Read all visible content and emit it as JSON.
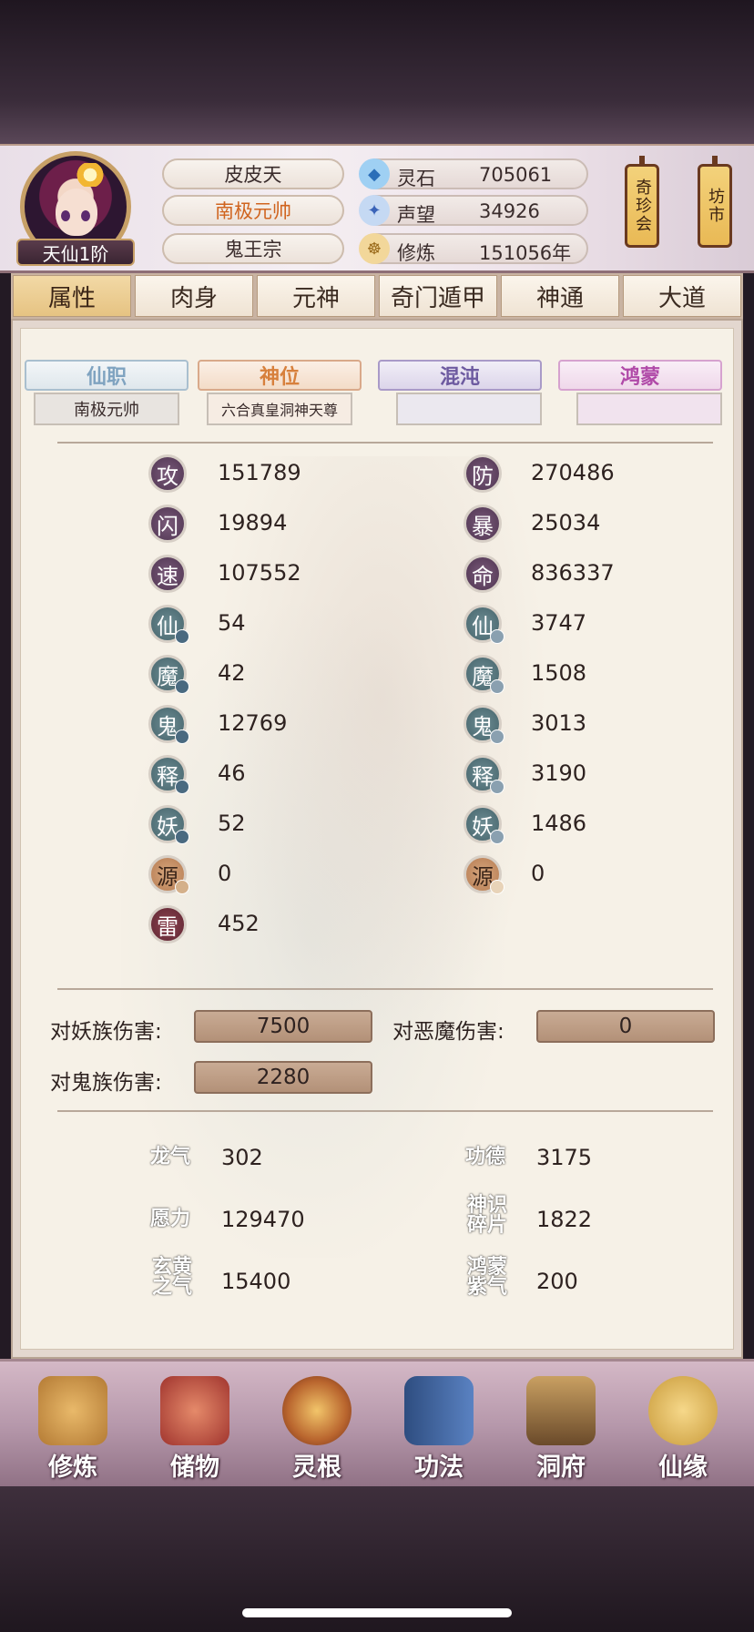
{
  "player": {
    "rank": "天仙1阶",
    "name": "皮皮天",
    "title": "南极元帅",
    "sect": "鬼王宗"
  },
  "resources": [
    {
      "label": "灵石",
      "value": "705061",
      "icon": "spirit-stone-icon",
      "color": "#4a90d9"
    },
    {
      "label": "声望",
      "value": "34926",
      "icon": "prestige-crystal-icon",
      "color": "#5a86d0"
    },
    {
      "label": "修炼",
      "value": "151056年",
      "icon": "meditation-icon",
      "color": "#d4a040"
    }
  ],
  "shops": {
    "treasure": "奇珍会",
    "market": "坊市"
  },
  "tabs": [
    "属性",
    "肉身",
    "元神",
    "奇门遁甲",
    "神通",
    "大道"
  ],
  "subtabs": [
    {
      "label": "仙职",
      "value": "南极元帅",
      "color": "#7fa3c0"
    },
    {
      "label": "神位",
      "value": "六合真皇洞神天尊",
      "color": "#d7803c"
    },
    {
      "label": "混沌",
      "value": "",
      "color": "#6d5aa0"
    },
    {
      "label": "鸿蒙",
      "value": "",
      "color": "#b04aa8"
    }
  ],
  "stats_left": [
    {
      "char": "攻",
      "value": "151789",
      "type": "purple"
    },
    {
      "char": "闪",
      "value": "19894",
      "type": "purple"
    },
    {
      "char": "速",
      "value": "107552",
      "type": "purple"
    },
    {
      "char": "仙",
      "value": "54",
      "type": "teal"
    },
    {
      "char": "魔",
      "value": "42",
      "type": "teal"
    },
    {
      "char": "鬼",
      "value": "12769",
      "type": "teal"
    },
    {
      "char": "释",
      "value": "46",
      "type": "teal"
    },
    {
      "char": "妖",
      "value": "52",
      "type": "teal"
    },
    {
      "char": "源",
      "value": "0",
      "type": "tan"
    },
    {
      "char": "雷",
      "value": "452",
      "type": "red"
    }
  ],
  "stats_right": [
    {
      "char": "防",
      "value": "270486",
      "type": "purple"
    },
    {
      "char": "暴",
      "value": "25034",
      "type": "purple"
    },
    {
      "char": "命",
      "value": "836337",
      "type": "purple"
    },
    {
      "char": "仙",
      "value": "3747",
      "type": "teal"
    },
    {
      "char": "魔",
      "value": "1508",
      "type": "teal"
    },
    {
      "char": "鬼",
      "value": "3013",
      "type": "teal"
    },
    {
      "char": "释",
      "value": "3190",
      "type": "teal"
    },
    {
      "char": "妖",
      "value": "1486",
      "type": "teal"
    },
    {
      "char": "源",
      "value": "0",
      "type": "tan"
    }
  ],
  "damage": {
    "vs_yao_label": "对妖族伤害:",
    "vs_yao": "7500",
    "vs_demon_label": "对恶魔伤害:",
    "vs_demon": "0",
    "vs_ghost_label": "对鬼族伤害:",
    "vs_ghost": "2280"
  },
  "misc": [
    {
      "label": "龙气",
      "value": "302"
    },
    {
      "label": "功德",
      "value": "3175"
    },
    {
      "label": "愿力",
      "value": "129470"
    },
    {
      "label": "神识碎片",
      "value": "1822"
    },
    {
      "label": "玄黄之气",
      "value": "15400"
    },
    {
      "label": "鸿蒙紫气",
      "value": "200"
    }
  ],
  "bottom_nav": [
    {
      "label": "修炼",
      "icon": "cultivation-icon",
      "color": "#c58a3e"
    },
    {
      "label": "储物",
      "icon": "storage-bag-icon",
      "color": "#c0504a"
    },
    {
      "label": "灵根",
      "icon": "spirit-root-icon",
      "color": "#b9652e"
    },
    {
      "label": "功法",
      "icon": "technique-book-icon",
      "color": "#4a6fa8"
    },
    {
      "label": "洞府",
      "icon": "cave-dwelling-icon",
      "color": "#8a6a42"
    },
    {
      "label": "仙缘",
      "icon": "fate-gourd-icon",
      "color": "#c89a3a"
    }
  ]
}
